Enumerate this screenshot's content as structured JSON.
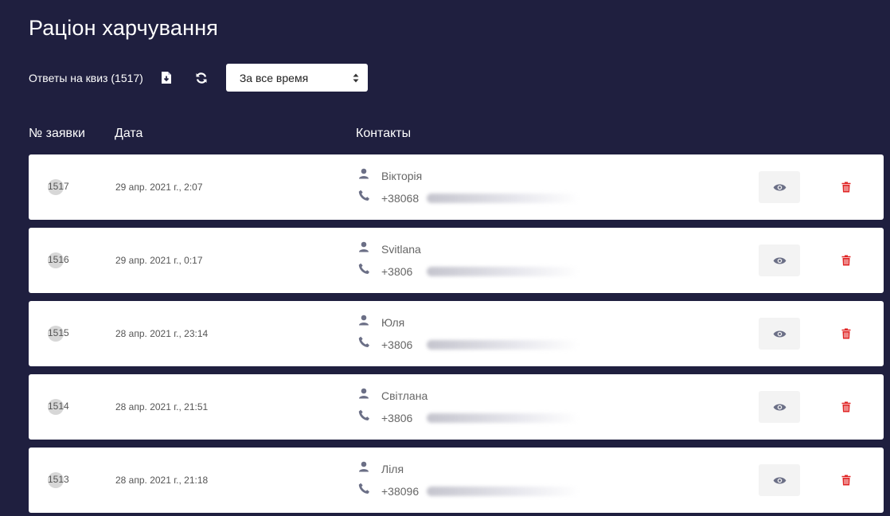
{
  "page": {
    "title": "Раціон харчування"
  },
  "toolbar": {
    "answers_label": "Ответы на квиз (1517)",
    "period_select": {
      "value": "За все время"
    }
  },
  "table": {
    "headers": {
      "number": "№ заявки",
      "date": "Дата",
      "contacts": "Контакты"
    },
    "rows": [
      {
        "number": "1517",
        "date": "29 апр. 2021 г., 2:07",
        "name": "Вікторія",
        "phone": "+38068"
      },
      {
        "number": "1516",
        "date": "29 апр. 2021 г., 0:17",
        "name": "Svitlana",
        "phone": "+3806"
      },
      {
        "number": "1515",
        "date": "28 апр. 2021 г., 23:14",
        "name": "Юля",
        "phone": "+3806"
      },
      {
        "number": "1514",
        "date": "28 апр. 2021 г., 21:51",
        "name": "Світлана",
        "phone": "+3806"
      },
      {
        "number": "1513",
        "date": "28 апр. 2021 г., 21:18",
        "name": "Ліля",
        "phone": "+38096"
      }
    ]
  },
  "colors": {
    "background": "#1f1f3f",
    "delete": "#e02424",
    "icon": "#6b6f86"
  },
  "icons": {
    "export": "file-download-icon",
    "refresh": "refresh-icon",
    "select": "sort-caret-icon",
    "user": "user-icon",
    "phone": "phone-icon",
    "view": "eye-icon",
    "delete": "trash-icon"
  }
}
